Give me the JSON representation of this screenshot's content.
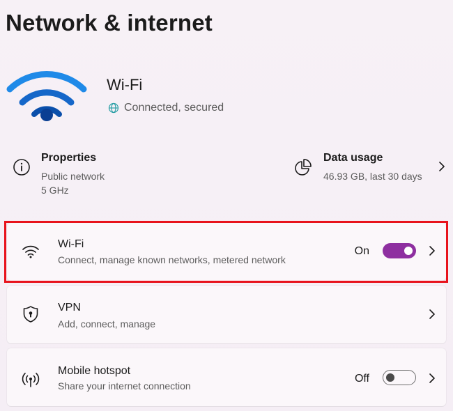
{
  "page": {
    "title": "Network & internet"
  },
  "hero": {
    "name": "Wi-Fi",
    "status": "Connected, secured"
  },
  "properties": {
    "title": "Properties",
    "lines": [
      "Public network",
      "5 GHz"
    ]
  },
  "data_usage": {
    "title": "Data usage",
    "detail": "46.93 GB, last 30 days"
  },
  "rows": [
    {
      "title": "Wi-Fi",
      "subtitle": "Connect, manage known networks, metered network",
      "state": "On",
      "toggle": true
    },
    {
      "title": "VPN",
      "subtitle": "Add, connect, manage"
    },
    {
      "title": "Mobile hotspot",
      "subtitle": "Share your internet connection",
      "state": "Off",
      "toggle": false
    }
  ],
  "colors": {
    "accent": "#8e2fa0",
    "wifi_blue": "#1a6fd0",
    "highlight": "#e8131c"
  }
}
